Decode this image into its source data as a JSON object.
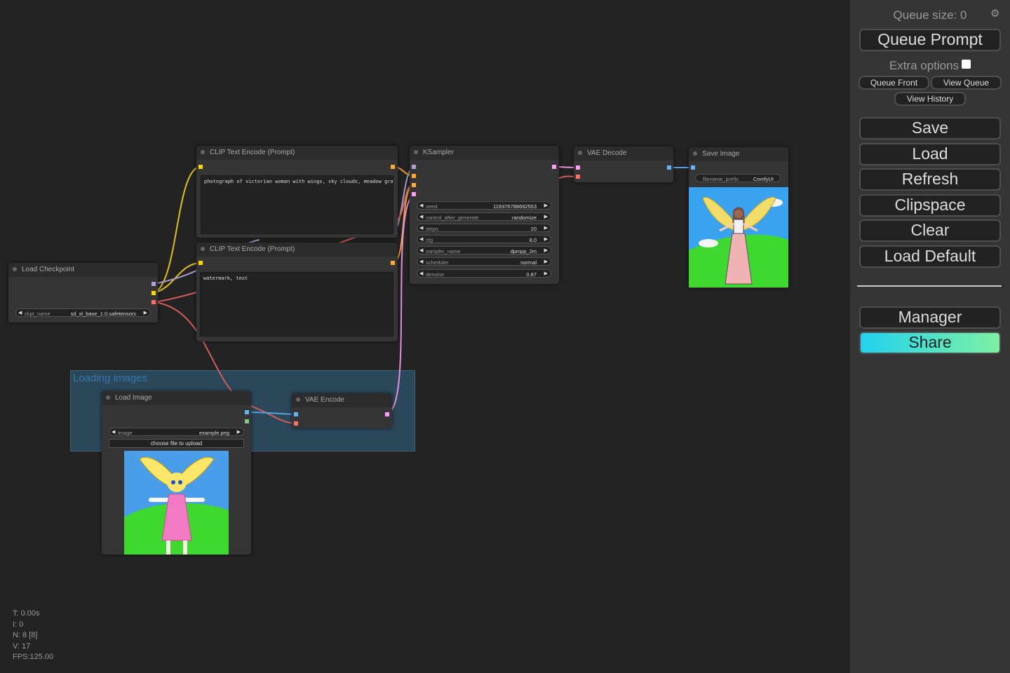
{
  "canvas": {
    "group_title": "Loading images",
    "nodes": {
      "load_checkpoint": {
        "title": "Load Checkpoint",
        "widgets": [
          {
            "name": "ckpt_name",
            "value": "sd_xl_base_1.0.safetensors"
          }
        ]
      },
      "clip_pos": {
        "title": "CLIP Text Encode (Prompt)",
        "text": "photograph of victorian woman with wings, sky clouds, meadow grass"
      },
      "clip_neg": {
        "title": "CLIP Text Encode (Prompt)",
        "text": "watermark, text"
      },
      "ksampler": {
        "title": "KSampler",
        "widgets": [
          {
            "name": "seed",
            "value": "119376788692553"
          },
          {
            "name": "control_after_generate",
            "value": "randomize"
          },
          {
            "name": "steps",
            "value": "20"
          },
          {
            "name": "cfg",
            "value": "8.0"
          },
          {
            "name": "sampler_name",
            "value": "dpmpp_2m"
          },
          {
            "name": "scheduler",
            "value": "normal"
          },
          {
            "name": "denoise",
            "value": "0.87"
          }
        ]
      },
      "vae_decode": {
        "title": "VAE Decode"
      },
      "save_image": {
        "title": "Save Image",
        "widgets": [
          {
            "name": "filename_prefix",
            "value": "ComfyUI"
          }
        ]
      },
      "load_image": {
        "title": "Load Image",
        "widgets": [
          {
            "name": "image",
            "value": "example.png"
          }
        ],
        "upload_label": "choose file to upload"
      },
      "vae_encode": {
        "title": "VAE Encode"
      }
    },
    "stats": {
      "t": "T: 0.00s",
      "i": "I: 0",
      "n": "N: 8 [8]",
      "v": "V: 17",
      "fps": "FPS:125.00"
    },
    "colors": {
      "clip_wire": "#ffd500",
      "model_wire": "#b39ddb",
      "vae_wire": "#ff6e6e",
      "conditioning_wire": "#ffa931",
      "latent_wire": "#ff9cf9",
      "image_wire": "#64b5f6",
      "mask_wire": "#81c784"
    }
  },
  "menu": {
    "queue_size": "Queue size: 0",
    "queue_prompt": "Queue Prompt",
    "extra_options": "Extra options",
    "queue_front": "Queue Front",
    "view_queue": "View Queue",
    "view_history": "View History",
    "save": "Save",
    "load": "Load",
    "refresh": "Refresh",
    "clipspace": "Clipspace",
    "clear": "Clear",
    "load_default": "Load Default",
    "manager": "Manager",
    "share": "Share",
    "settings_icon": "gear-icon"
  }
}
